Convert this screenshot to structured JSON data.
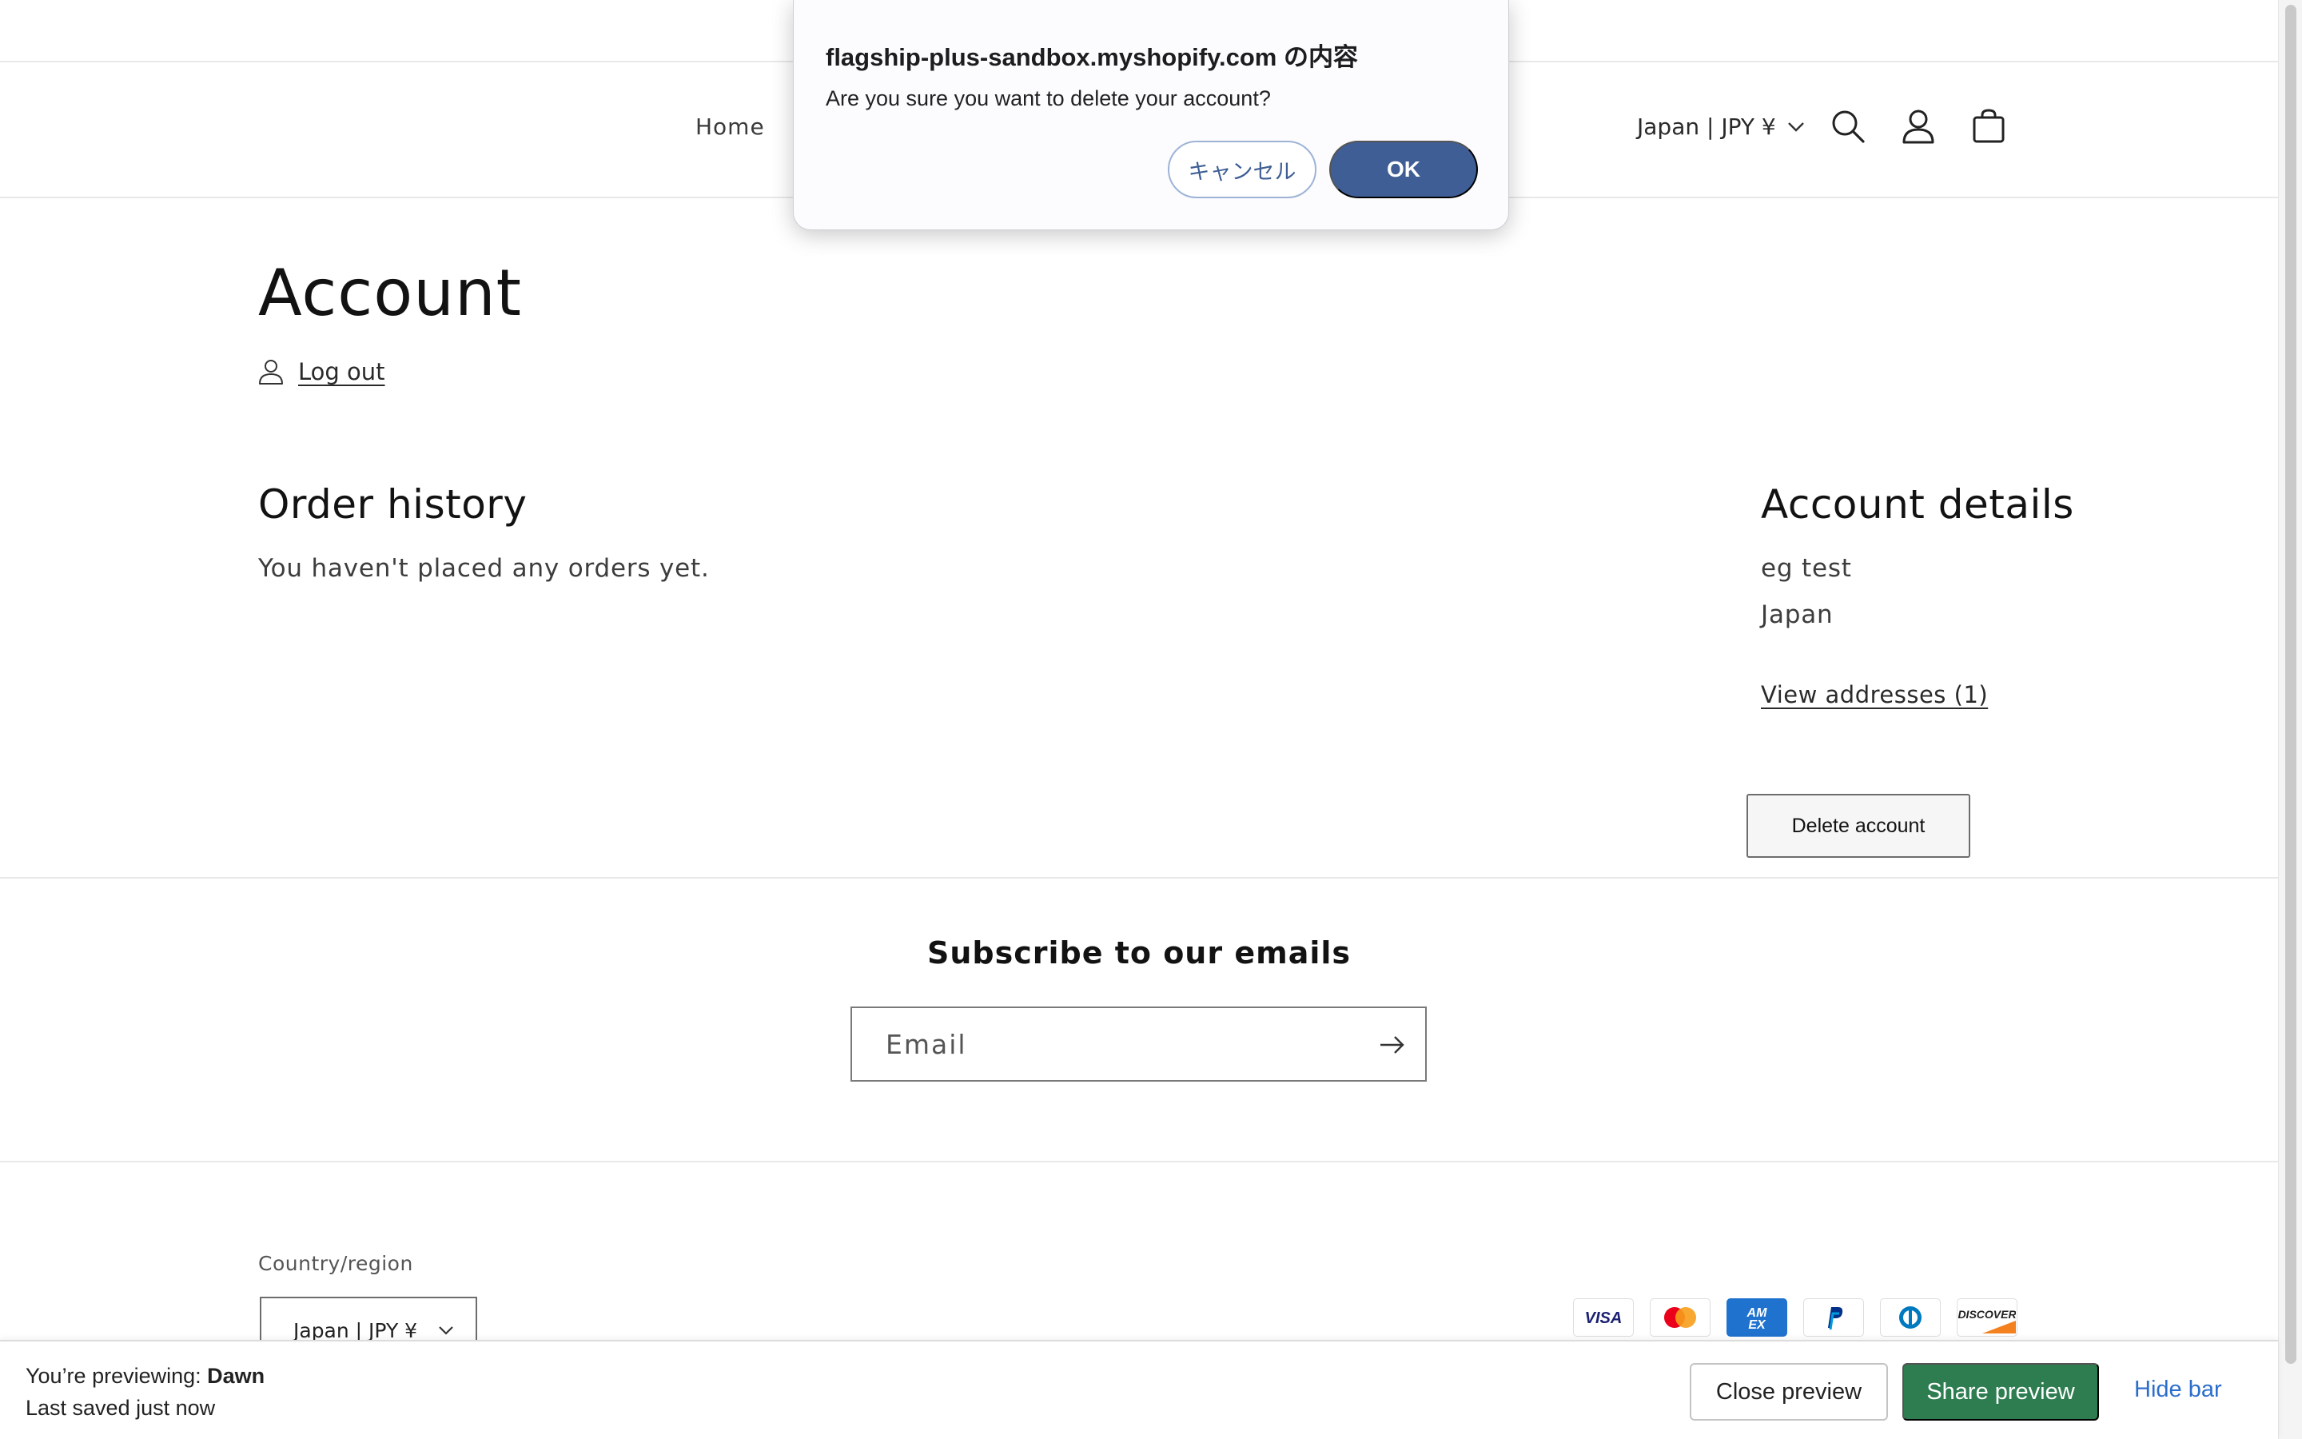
{
  "header": {
    "nav_home": "Home",
    "locale": "Japan | JPY ¥"
  },
  "account": {
    "title": "Account",
    "logout": "Log out",
    "order_history_title": "Order history",
    "no_orders": "You haven't placed any orders yet.",
    "details_title": "Account details",
    "name": "eg test",
    "country": "Japan",
    "view_addresses": "View addresses (1)",
    "delete_button": "Delete account"
  },
  "newsletter": {
    "title": "Subscribe to our emails",
    "email_placeholder": "Email"
  },
  "footer": {
    "country_label": "Country/region",
    "country_value": "Japan | JPY ¥",
    "payments": [
      "Visa",
      "Mastercard",
      "American Express",
      "PayPal",
      "Diners Club",
      "Discover"
    ]
  },
  "preview_bar": {
    "previewing_label": "You’re previewing:",
    "theme_name": "Dawn",
    "saved_status": "Last saved just now",
    "close_preview": "Close preview",
    "share_preview": "Share preview",
    "hide_bar": "Hide bar"
  },
  "dialog": {
    "title": "flagship-plus-sandbox.myshopify.com の内容",
    "message": "Are you sure you want to delete your account?",
    "cancel": "キャンセル",
    "ok": "OK"
  },
  "colors": {
    "accent_green": "#2e7d51",
    "dialog_blue": "#3e5e95",
    "link_blue": "#2c6ecb"
  }
}
